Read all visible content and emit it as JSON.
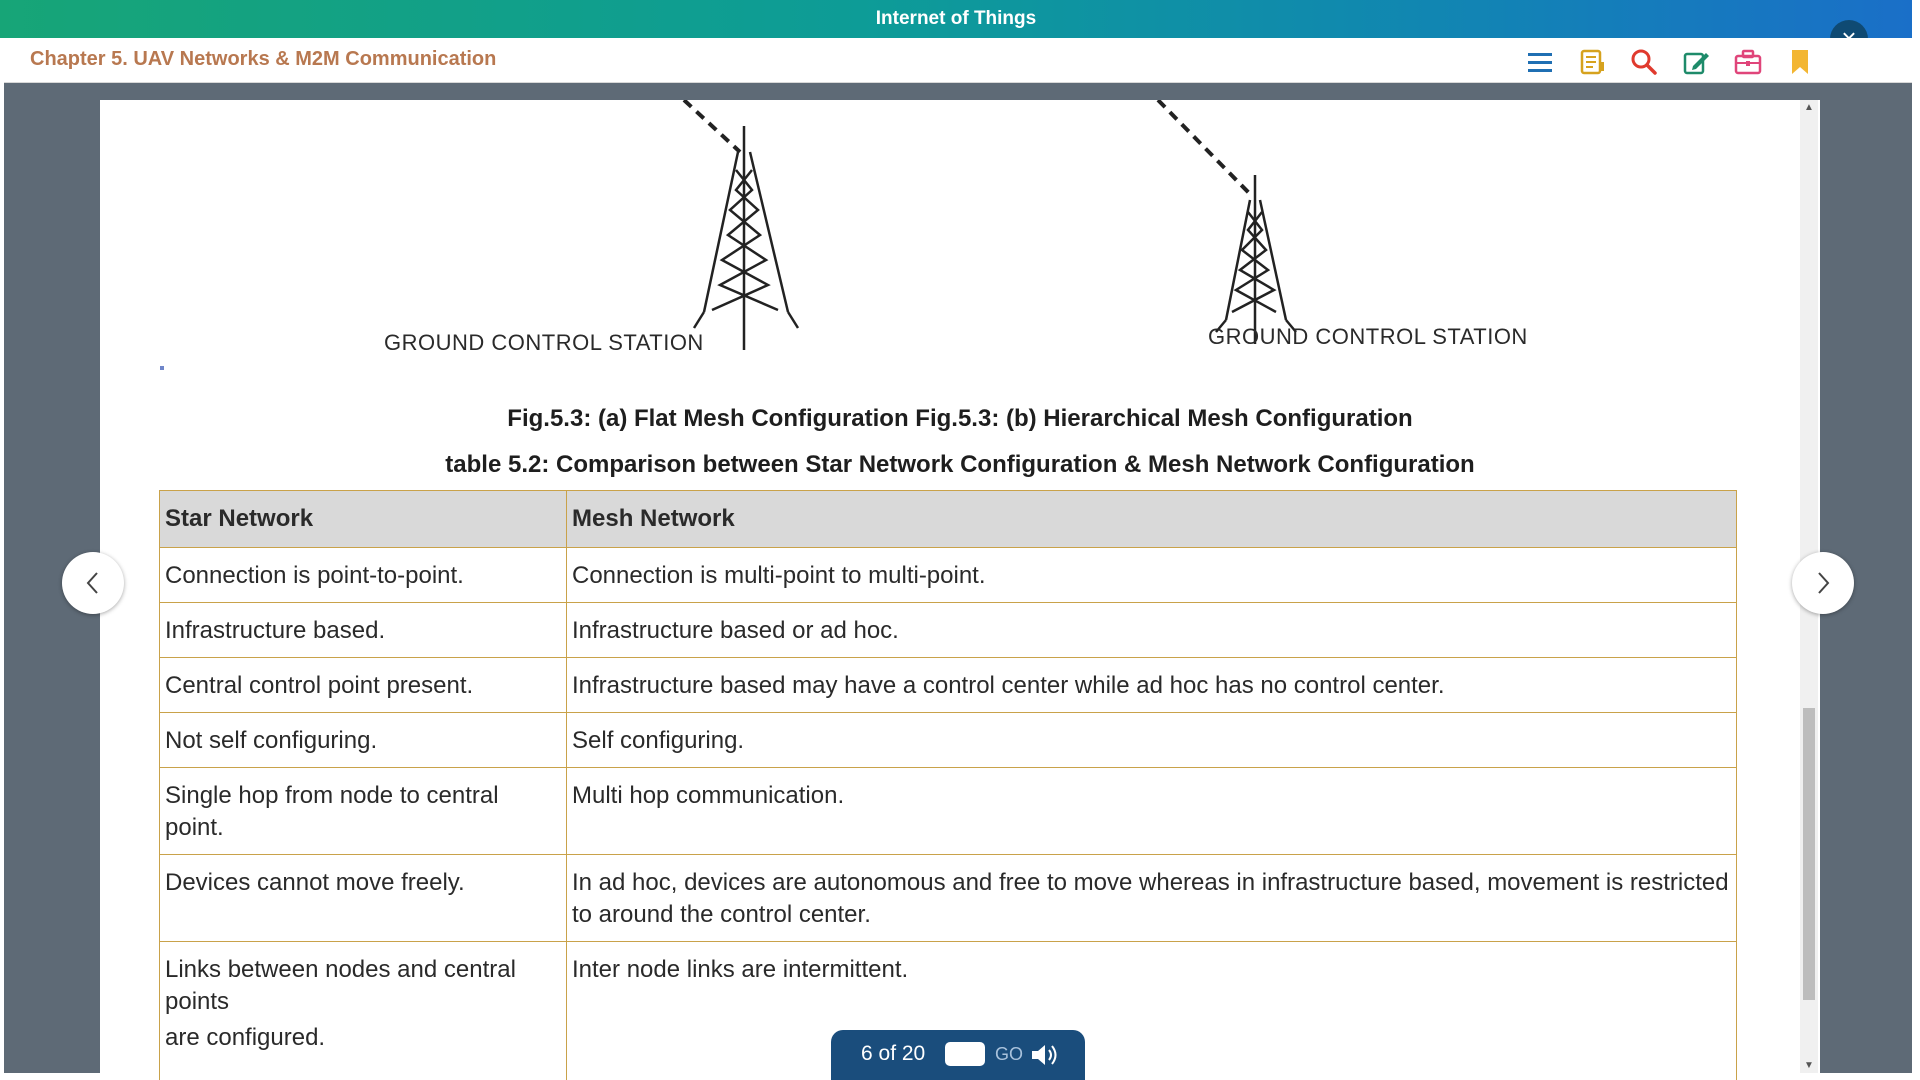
{
  "app": {
    "title": "Internet of Things"
  },
  "chapter": {
    "title": "Chapter 5. UAV Networks & M2M Communication"
  },
  "toolbar": {
    "icons": [
      "menu-icon",
      "notes-icon",
      "search-icon",
      "edit-icon",
      "toolbox-icon",
      "bookmark-icon"
    ],
    "close_glyph": "×"
  },
  "figure": {
    "left_label": "GROUND CONTROL STATION",
    "right_label": "GROUND CONTROL STATION",
    "caption": "Fig.5.3: (a) Flat Mesh Configuration Fig.5.3: (b) Hierarchical Mesh Configuration"
  },
  "table": {
    "caption": "table 5.2: Comparison between Star Network Configuration & Mesh Network Configuration",
    "headers": [
      "Star Network",
      "Mesh Network"
    ],
    "rows": [
      [
        "Connection is point-to-point.",
        "Connection is multi-point to multi-point."
      ],
      [
        "Infrastructure based.",
        "Infrastructure based or ad hoc."
      ],
      [
        "Central control point present.",
        "Infrastructure based may have a control center while ad hoc has no control center."
      ],
      [
        "Not self configuring.",
        "Self configuring."
      ],
      [
        "Single hop from node to central point.",
        "Multi hop communication."
      ],
      [
        "Devices cannot move freely.",
        "In ad hoc, devices are autonomous and free to move whereas in infrastructure based, movement is restricted to around the control center."
      ],
      [
        "Links between nodes and central points",
        "Inter node links are intermittent."
      ]
    ],
    "row7_extra": "are configured."
  },
  "pager": {
    "text": "6 of 20",
    "go_label": "GO",
    "input_value": ""
  },
  "colors": {
    "accent": "#1a4d7c",
    "chapter_title": "#b87850",
    "table_border": "#c9a24a"
  }
}
